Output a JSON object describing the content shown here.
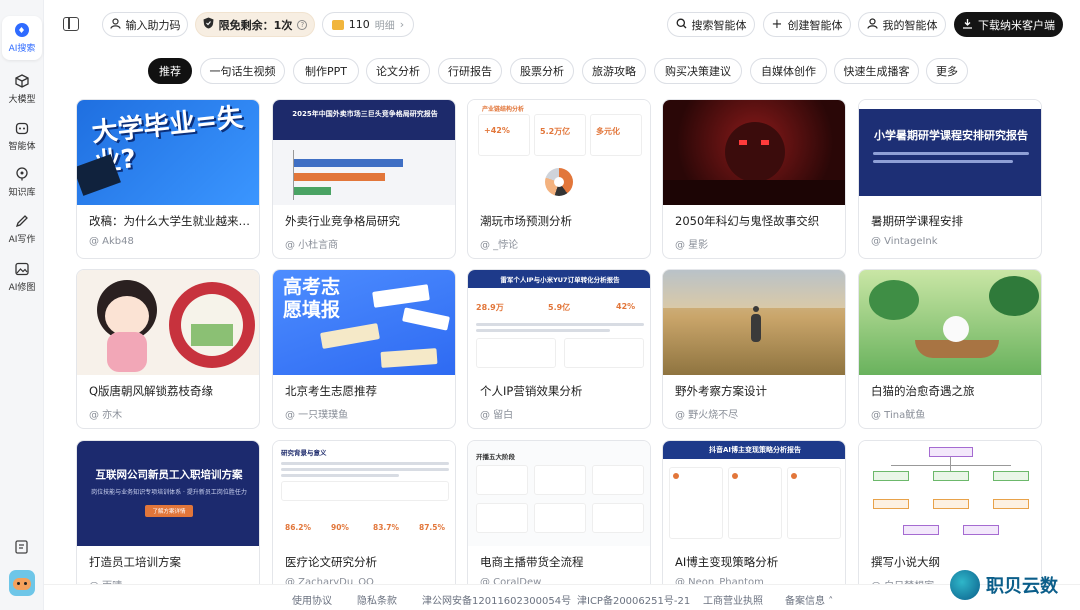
{
  "sidebar": {
    "items": [
      {
        "label": "AI搜索",
        "icon": "ai-search-icon",
        "active": true
      },
      {
        "label": "大模型",
        "icon": "cube-icon"
      },
      {
        "label": "智能体",
        "icon": "robot-icon"
      },
      {
        "label": "知识库",
        "icon": "knowledge-icon"
      },
      {
        "label": "AI写作",
        "icon": "pen-icon"
      },
      {
        "label": "AI修图",
        "icon": "image-icon"
      }
    ]
  },
  "topbar": {
    "invite_code": "输入助力码",
    "free_label": "限免剩余：1次",
    "coins": "110",
    "coins_detail": "明细",
    "search_agent": "搜索智能体",
    "create_agent": "创建智能体",
    "my_agent": "我的智能体",
    "download": "下载纳米客户端"
  },
  "categories": [
    "推荐",
    "一句话生视频",
    "制作PPT",
    "论文分析",
    "行研报告",
    "股票分析",
    "旅游攻略",
    "购买决策建议",
    "自媒体创作",
    "快速生成播客",
    "更多"
  ],
  "cards": [
    {
      "title": "改稿：为什么大学生就业越来越难",
      "author": "@ Akb48",
      "thumb_text": "大学毕业=失业?"
    },
    {
      "title": "外卖行业竞争格局研究",
      "author": "@ 小杜言商",
      "thumb_text": "2025年中国外卖市场三巨头竞争格局研究报告"
    },
    {
      "title": "潮玩市场预测分析",
      "author": "@ _悖论",
      "thumb_text": "产业链结构分析",
      "metrics": [
        "+42%",
        "5.2万亿",
        "多元化"
      ]
    },
    {
      "title": "2050年科幻与鬼怪故事交织",
      "author": "@ 星影"
    },
    {
      "title": "暑期研学课程安排",
      "author": "@ VintageInk",
      "thumb_text": "小学暑期研学课程安排研究报告"
    },
    {
      "title": "Q版唐朝风解锁荔枝奇缘",
      "author": "@ 亦木"
    },
    {
      "title": "北京考生志愿推荐",
      "author": "@ 一只璞璞鱼",
      "thumb_text": "高考志愿填报"
    },
    {
      "title": "个人IP营销效果分析",
      "author": "@ 留白",
      "thumb_text": "雷军个人IP与小米YU7订单转化分析报告",
      "metrics": [
        "28.9万",
        "5.9亿",
        "42%"
      ]
    },
    {
      "title": "野外考察方案设计",
      "author": "@ 野火烧不尽"
    },
    {
      "title": "白猫的治愈奇遇之旅",
      "author": "@ Tina鱿鱼"
    },
    {
      "title": "打造员工培训方案",
      "author": "@ 雨晴",
      "thumb_text": "互联网公司新员工入职培训方案",
      "thumb_sub": "岗位技能与业务知识专项培训体系 · 提升新员工岗位胜任力",
      "thumb_btn": "了解方案详情"
    },
    {
      "title": "医疗论文研究分析",
      "author": "@ ZacharyDu_OO",
      "thumb_text": "研究背景与意义",
      "metrics": [
        "86.2%",
        "90%",
        "83.7%",
        "87.5%"
      ]
    },
    {
      "title": "电商主播带货全流程",
      "author": "@ CoralDew",
      "thumb_text": "开播五大阶段"
    },
    {
      "title": "AI博主变现策略分析",
      "author": "@ Neon_Phantom",
      "thumb_text": "抖音AI博主变现策略分析报告"
    },
    {
      "title": "撰写小说大纲",
      "author": "@ 白日梦想家"
    }
  ],
  "footer": {
    "terms": "使用协议",
    "privacy": "隐私条款",
    "police": "津公网安备12011602300054号",
    "icp": "津ICP备20006251号-21",
    "license": "工商营业执照",
    "filing": "备案信息"
  },
  "watermark": "职贝云数",
  "colors": {
    "accent": "#2f6bff",
    "dark": "#141414",
    "navy": "#1d2a6b"
  }
}
